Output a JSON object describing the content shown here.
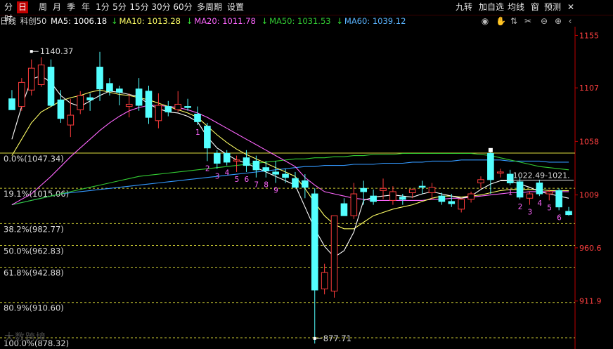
{
  "toolbar": {
    "left_items": [
      "分时",
      "日",
      "周",
      "月",
      "季",
      "年",
      "1分",
      "5分",
      "15分",
      "30分",
      "60分",
      "多周期",
      "设置"
    ],
    "active": "日",
    "right_items": [
      "九转",
      "加自选",
      "均线",
      "窗",
      "预测"
    ],
    "close_icon": "close-x-icon"
  },
  "info": {
    "period": "日线",
    "name": "科创50",
    "ma5": "MA5: 1006.18",
    "ma10": "MA10: 1013.28",
    "ma20": "MA20: 1011.78",
    "ma50": "MA50: 1031.53",
    "ma60": "MA60: 1039.12",
    "arrow": "↓"
  },
  "colors": {
    "up": "#ff3c3c",
    "down": "#54ffff",
    "ma5": "#ffffff",
    "ma10": "#ffff66",
    "ma20": "#ff66ff",
    "ma50": "#33cc33",
    "ma60": "#3399ff",
    "axis": "#c00000",
    "fib": "#cccc33",
    "count": "#ff66ff"
  },
  "y_axis": {
    "labels": [
      "1155",
      "1107",
      "1058",
      "1009",
      "960.6",
      "911.9"
    ]
  },
  "fibonacci": [
    {
      "label": "0.0%(1047.34)",
      "value": 1047.34,
      "solid": true
    },
    {
      "label": "19.1%(1015.06)",
      "value": 1015.06
    },
    {
      "label": "38.2%(982.77)",
      "value": 982.77
    },
    {
      "label": "50.0%(962.83)",
      "value": 962.83
    },
    {
      "label": "61.8%(942.88)",
      "value": 942.88
    },
    {
      "label": "80.9%(910.60)",
      "value": 910.6
    },
    {
      "label": "100.0%(878.32)",
      "value": 878.32
    }
  ],
  "annotations": {
    "high": "1140.37",
    "low": "877.71",
    "line_label": "1022.49-1021."
  },
  "watermark": "大数跨境",
  "chart_data": {
    "type": "candlestick",
    "y_range": [
      868,
      1163
    ],
    "candles": [
      [
        1097,
        1105,
        1088,
        1087
      ],
      [
        1090,
        1116,
        1086,
        1112
      ],
      [
        1105,
        1133,
        1100,
        1125
      ],
      [
        1110,
        1135,
        1108,
        1128
      ],
      [
        1126,
        1133,
        1090,
        1091
      ],
      [
        1096,
        1105,
        1075,
        1079
      ],
      [
        1073,
        1097,
        1062,
        1082
      ],
      [
        1087,
        1104,
        1083,
        1100
      ],
      [
        1098,
        1102,
        1086,
        1096
      ],
      [
        1126,
        1140,
        1095,
        1106
      ],
      [
        1111,
        1116,
        1100,
        1104
      ],
      [
        1106,
        1109,
        1091,
        1103
      ],
      [
        1090,
        1102,
        1080,
        1092
      ],
      [
        1106,
        1116,
        1086,
        1091
      ],
      [
        1104,
        1109,
        1074,
        1080
      ],
      [
        1077,
        1102,
        1070,
        1091
      ],
      [
        1090,
        1095,
        1081,
        1085
      ],
      [
        1087,
        1104,
        1085,
        1092
      ],
      [
        1090,
        1097,
        1086,
        1089
      ],
      [
        1083,
        1090,
        1073,
        1076
      ],
      [
        1072,
        1075,
        1040,
        1052
      ],
      [
        1047,
        1050,
        1033,
        1038
      ],
      [
        1047,
        1050,
        1036,
        1039
      ],
      [
        1040,
        1045,
        1030,
        1041
      ],
      [
        1043,
        1050,
        1030,
        1036
      ],
      [
        1040,
        1045,
        1025,
        1032
      ],
      [
        1034,
        1040,
        1025,
        1031
      ],
      [
        1030,
        1040,
        1020,
        1028
      ],
      [
        1028,
        1033,
        1020,
        1025
      ],
      [
        1024,
        1030,
        1018,
        1016
      ],
      [
        1022,
        1028,
        1006,
        1016
      ],
      [
        1010,
        1015,
        873,
        922
      ],
      [
        923,
        946,
        918,
        938
      ],
      [
        921,
        987,
        915,
        990
      ],
      [
        1001,
        1006,
        990,
        990
      ],
      [
        990,
        1020,
        987,
        1010
      ],
      [
        1015,
        1022,
        1000,
        1012
      ],
      [
        1008,
        1014,
        1000,
        1003
      ],
      [
        1013,
        1024,
        1005,
        1015
      ],
      [
        1004,
        1017,
        1000,
        1012
      ],
      [
        1007,
        1010,
        1000,
        1005
      ],
      [
        1011,
        1015,
        1006,
        1014
      ],
      [
        1017,
        1022,
        1010,
        1016
      ],
      [
        1011,
        1020,
        1005,
        1016
      ],
      [
        1008,
        1011,
        1000,
        1003
      ],
      [
        1003,
        1010,
        998,
        1001
      ],
      [
        996,
        1006,
        993,
        1005
      ],
      [
        1005,
        1012,
        1002,
        1010
      ],
      [
        1020,
        1026,
        1015,
        1023
      ],
      [
        1047,
        1050,
        1010,
        1023
      ],
      [
        1029,
        1033,
        1025,
        1030
      ],
      [
        1028,
        1032,
        1018,
        1020
      ],
      [
        1021,
        1025,
        1005,
        1007
      ],
      [
        1006,
        1012,
        1000,
        1010
      ],
      [
        1020,
        1023,
        1008,
        1010
      ],
      [
        1010,
        1014,
        1004,
        1012
      ],
      [
        1013,
        1015,
        995,
        998
      ],
      [
        994,
        998,
        990,
        991
      ]
    ],
    "ma5": [
      1060,
      1090,
      1115,
      1118,
      1112,
      1100,
      1093,
      1090,
      1095,
      1100,
      1104,
      1103,
      1101,
      1099,
      1092,
      1088,
      1085,
      1084,
      1081,
      1076,
      1062,
      1052,
      1046,
      1041,
      1038,
      1034,
      1030,
      1026,
      1022,
      1018,
      998,
      978,
      962,
      952,
      958,
      975,
      1004,
      1007,
      1008,
      1009,
      1008,
      1007,
      1010,
      1012,
      1010,
      1008,
      1006,
      1008,
      1014,
      1019,
      1022,
      1022,
      1019,
      1016,
      1012,
      1010,
      1008,
      1006
    ],
    "ma10": [
      1045,
      1060,
      1075,
      1085,
      1090,
      1095,
      1098,
      1100,
      1103,
      1105,
      1103,
      1101,
      1100,
      1098,
      1096,
      1093,
      1090,
      1087,
      1084,
      1080,
      1072,
      1064,
      1057,
      1051,
      1046,
      1042,
      1038,
      1034,
      1030,
      1026,
      1015,
      1002,
      990,
      982,
      978,
      978,
      984,
      990,
      993,
      996,
      998,
      1000,
      1003,
      1006,
      1008,
      1008,
      1007,
      1008,
      1009,
      1011,
      1013,
      1014,
      1014,
      1014,
      1014,
      1013,
      1013,
      1013
    ],
    "ma20": [
      1000,
      1005,
      1010,
      1018,
      1026,
      1035,
      1044,
      1052,
      1060,
      1068,
      1075,
      1081,
      1086,
      1089,
      1091,
      1091,
      1090,
      1089,
      1087,
      1084,
      1080,
      1075,
      1070,
      1065,
      1060,
      1055,
      1050,
      1045,
      1040,
      1035,
      1025,
      1018,
      1012,
      1010,
      1008,
      1006,
      1005,
      1004,
      1004,
      1004,
      1004,
      1004,
      1004,
      1005,
      1005,
      1006,
      1006,
      1007,
      1008,
      1009,
      1010,
      1011,
      1011,
      1012,
      1012,
      1012,
      1012,
      1012
    ],
    "ma50": [
      1000,
      1002,
      1004,
      1006,
      1008,
      1010,
      1012,
      1014,
      1016,
      1018,
      1020,
      1022,
      1024,
      1026,
      1027,
      1028,
      1029,
      1030,
      1031,
      1032,
      1033,
      1034,
      1035,
      1036,
      1037,
      1038,
      1039,
      1040,
      1041,
      1042,
      1042,
      1043,
      1043,
      1044,
      1044,
      1045,
      1045,
      1046,
      1046,
      1046,
      1047,
      1047,
      1047,
      1047,
      1047,
      1047,
      1047,
      1047,
      1046,
      1045,
      1043,
      1041,
      1039,
      1037,
      1035,
      1034,
      1033,
      1032
    ],
    "ma60": [
      1000,
      1002,
      1004,
      1006,
      1008,
      1010,
      1011,
      1012,
      1013,
      1014,
      1015,
      1016,
      1017,
      1018,
      1019,
      1020,
      1021,
      1022,
      1023,
      1024,
      1025,
      1026,
      1027,
      1028,
      1029,
      1030,
      1031,
      1032,
      1033,
      1034,
      1035,
      1035,
      1036,
      1036,
      1036,
      1037,
      1037,
      1037,
      1038,
      1038,
      1038,
      1039,
      1039,
      1040,
      1040,
      1040,
      1041,
      1041,
      1041,
      1041,
      1041,
      1040,
      1040,
      1040,
      1040,
      1039,
      1039,
      1039
    ],
    "counts": [
      {
        "n": "1",
        "i": 19
      },
      {
        "n": "2",
        "i": 20
      },
      {
        "n": "3",
        "i": 21
      },
      {
        "n": "4",
        "i": 22
      },
      {
        "n": "5",
        "i": 23
      },
      {
        "n": "6",
        "i": 24
      },
      {
        "n": "7",
        "i": 25
      },
      {
        "n": "8",
        "i": 26
      },
      {
        "n": "9",
        "i": 27
      },
      {
        "n": "1",
        "i": 51
      },
      {
        "n": "2",
        "i": 52
      },
      {
        "n": "3",
        "i": 53
      },
      {
        "n": "4",
        "i": 54
      },
      {
        "n": "5",
        "i": 55
      },
      {
        "n": "6",
        "i": 56
      }
    ]
  }
}
